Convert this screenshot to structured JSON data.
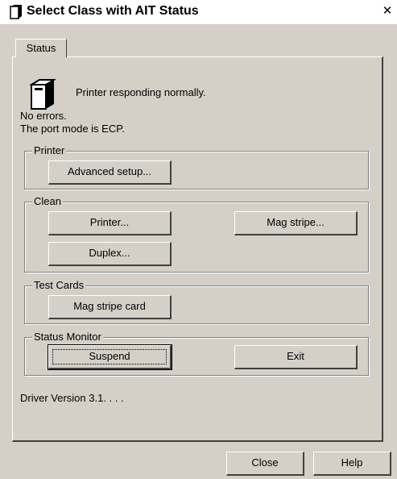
{
  "window": {
    "title": "Select Class with AIT Status",
    "close_symbol": "✕"
  },
  "tabs": [
    {
      "label": "Status"
    }
  ],
  "status": {
    "message": "Printer responding normally.",
    "errors": "No errors.",
    "port_mode": "The port mode is ECP."
  },
  "groups": {
    "printer": {
      "label": "Printer",
      "advanced_setup": "Advanced setup..."
    },
    "clean": {
      "label": "Clean",
      "printer": "Printer...",
      "mag_stripe": "Mag stripe...",
      "duplex": "Duplex..."
    },
    "test_cards": {
      "label": "Test Cards",
      "mag_stripe_card": "Mag stripe card"
    },
    "status_monitor": {
      "label": "Status Monitor",
      "suspend": "Suspend",
      "exit": "Exit"
    }
  },
  "driver_version": "Driver Version  3.1. . . .",
  "footer": {
    "close": "Close",
    "help": "Help"
  },
  "icons": {
    "title": "printer-icon",
    "status": "printer-icon"
  }
}
